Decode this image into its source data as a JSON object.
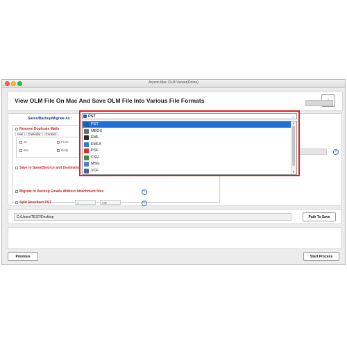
{
  "window": {
    "title": "Aryson Mac OLM Viewer(Demo)"
  },
  "header": {
    "title": "View OLM File On Mac And Save OLM File Into Various File Formats",
    "info_label": "i"
  },
  "saves": {
    "label": "Saves/Backup/Migrate As :"
  },
  "options": {
    "remove_duplicates": "Remove Duplicate Mails",
    "tabs": [
      "Mail",
      "Calendar",
      "Contact"
    ],
    "fields": [
      "To",
      "From",
      "Bcc",
      "Body"
    ],
    "save_same": "Save in Same(Source and Destination Fo",
    "migrate_no_attach": "Migrate or Backup Emails Without Attachment files",
    "split_pst": "Split Resultant PST",
    "split_value": "1",
    "split_unit": "MB"
  },
  "dropdown": {
    "selected": "PST",
    "items": [
      {
        "label": "PST",
        "icon": "pst-icon",
        "color": "#1e5fa8"
      },
      {
        "label": "MBOX",
        "icon": "mbox-icon",
        "color": "#6d6d6d"
      },
      {
        "label": "EML",
        "icon": "eml-icon",
        "color": "#2b2b2b"
      },
      {
        "label": "EMLX",
        "icon": "emlx-icon",
        "color": "#2f7dd1"
      },
      {
        "label": "PDF",
        "icon": "pdf-icon",
        "color": "#d6312b"
      },
      {
        "label": "CSV",
        "icon": "csv-icon",
        "color": "#3b8d3b"
      },
      {
        "label": "MSG",
        "icon": "msg-icon",
        "color": "#4a86c8"
      },
      {
        "label": "VCF",
        "icon": "vcf-icon",
        "color": "#5a5a9a"
      }
    ]
  },
  "path": {
    "value": "C:/Users/TEST/Desktop",
    "button": "Path To Save"
  },
  "footer": {
    "previous": "Previous",
    "start": "Start Process"
  },
  "colors": {
    "highlight": "#e01b24",
    "selection": "#1f6fd6",
    "red_text": "#c62828",
    "blue_label": "#1b3a8c"
  }
}
